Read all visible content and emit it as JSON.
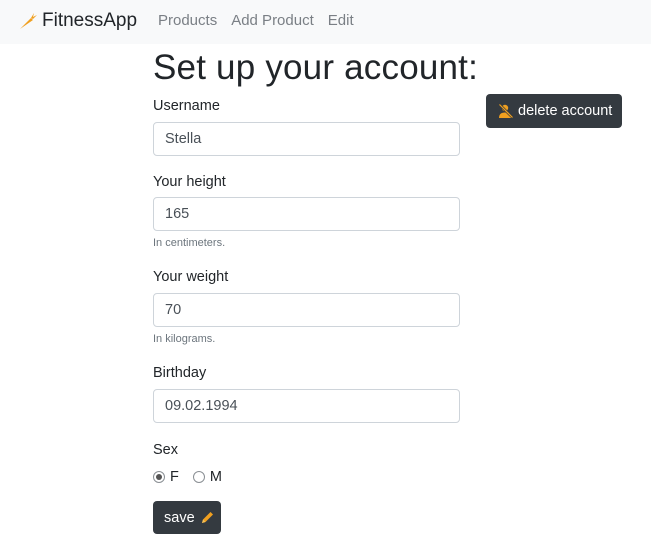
{
  "navbar": {
    "brand": "FitnessApp",
    "brand_icon": "carrot-icon",
    "links": [
      "Products",
      "Add Product",
      "Edit"
    ]
  },
  "page": {
    "title": "Set up your account:"
  },
  "form": {
    "username": {
      "label": "Username",
      "value": "Stella"
    },
    "height": {
      "label": "Your height",
      "value": "165",
      "help": "In centimeters."
    },
    "weight": {
      "label": "Your weight",
      "value": "70",
      "help": "In kilograms."
    },
    "birthday": {
      "label": "Birthday",
      "value": "09.02.1994"
    },
    "sex": {
      "label": "Sex",
      "options": [
        "F",
        "M"
      ],
      "selected": "F"
    },
    "save_label": "save",
    "save_icon": "pencil-icon"
  },
  "actions": {
    "delete_label": "delete account",
    "delete_icon": "user-slash-icon"
  },
  "colors": {
    "accent": "#f0a020",
    "dark_button": "#343a40",
    "navbar_bg": "#f8f9fa"
  }
}
